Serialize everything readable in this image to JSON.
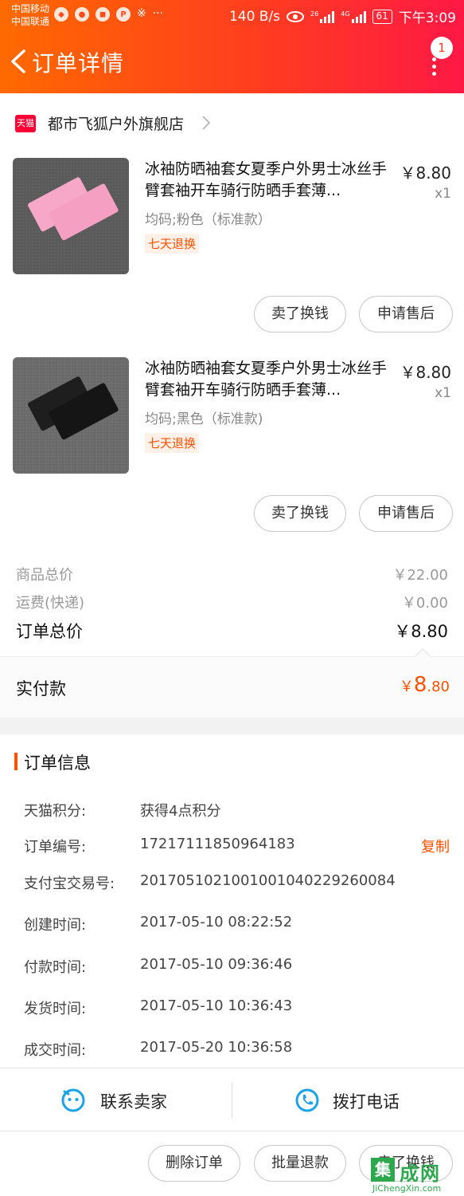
{
  "status_bar": {
    "carrier_1": "中国移动",
    "carrier_2": "中国联通",
    "net_speed": "140 B/s",
    "signal_1": "26",
    "signal_2": "4G",
    "battery": "61",
    "time": "下午3:09"
  },
  "header": {
    "title": "订单详情",
    "badge_count": "1"
  },
  "shop": {
    "logo_text": "天猫",
    "name": "都市飞狐户外旗舰店"
  },
  "items": [
    {
      "title": "冰袖防晒袖套女夏季户外男士冰丝手臂套袖开车骑行防晒手套薄...",
      "price": "￥8.80",
      "qty": "x1",
      "spec": "均码;粉色（标准款）",
      "tag": "七天退换",
      "color": "#f7a8c8",
      "btn_sell": "卖了换钱",
      "btn_after": "申请售后"
    },
    {
      "title": "冰袖防晒袖套女夏季户外男士冰丝手臂套袖开车骑行防晒手套薄...",
      "price": "￥8.80",
      "qty": "x1",
      "spec": "均码;黑色（标准款)",
      "tag": "七天退换",
      "color": "#1e1e1e",
      "btn_sell": "卖了换钱",
      "btn_after": "申请售后"
    }
  ],
  "summary": {
    "goods_label": "商品总价",
    "goods_value": "￥22.00",
    "shipping_label": "运费(快递)",
    "shipping_value": "￥0.00",
    "total_label": "订单总价",
    "total_value": "￥8.80",
    "paid_label": "实付款",
    "paid_currency": "￥",
    "paid_int": "8",
    "paid_dec": ".80"
  },
  "order_info": {
    "section_title": "订单信息",
    "copy_label": "复制",
    "rows": [
      {
        "label": "天猫积分:",
        "value": "获得4点积分"
      },
      {
        "label": "订单编号:",
        "value": "17217111850964183"
      },
      {
        "label": "支付宝交易号:",
        "value": "2017051021001001040229260084"
      },
      {
        "label": "创建时间:",
        "value": "2017-05-10 08:22:52"
      },
      {
        "label": "付款时间:",
        "value": "2017-05-10 09:36:46"
      },
      {
        "label": "发货时间:",
        "value": "2017-05-10 10:36:43"
      },
      {
        "label": "成交时间:",
        "value": "2017-05-20 10:36:58"
      }
    ]
  },
  "contact": {
    "seller_label": "联系卖家",
    "phone_label": "拨打电话"
  },
  "actions": {
    "delete_label": "删除订单",
    "bulk_refund_label": "批量退款",
    "sell_label": "卖了换钱"
  },
  "watermark": {
    "box_char": "集",
    "text": "成网",
    "url": "JiChengXin.com"
  },
  "colors": {
    "accent": "#ff5000",
    "header_start": "#ff6a00",
    "header_end": "#ff1845",
    "contact_icon": "#1aa3ea"
  }
}
